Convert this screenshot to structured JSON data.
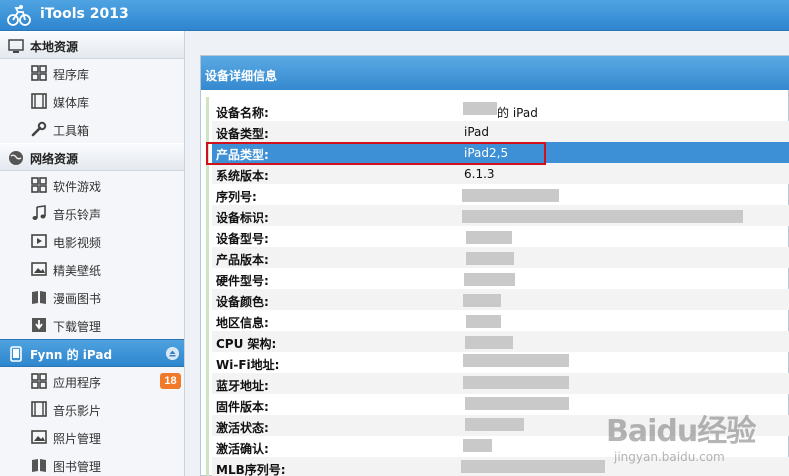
{
  "app": {
    "title": "iTools 2013"
  },
  "sidebar": {
    "sections": [
      {
        "label": "本地资源",
        "icon": "monitor-icon",
        "items": [
          {
            "label": "程序库",
            "icon": "grid-icon"
          },
          {
            "label": "媒体库",
            "icon": "film-icon"
          },
          {
            "label": "工具箱",
            "icon": "wrench-icon"
          }
        ]
      },
      {
        "label": "网络资源",
        "icon": "globe-icon",
        "items": [
          {
            "label": "软件游戏",
            "icon": "grid-icon"
          },
          {
            "label": "音乐铃声",
            "icon": "music-note-icon"
          },
          {
            "label": "电影视频",
            "icon": "video-icon"
          },
          {
            "label": "精美壁纸",
            "icon": "picture-icon"
          },
          {
            "label": "漫画图书",
            "icon": "book-icon"
          },
          {
            "label": "下载管理",
            "icon": "download-icon"
          }
        ]
      },
      {
        "label": "Fynn 的 iPad",
        "icon": "tablet-icon",
        "active": true,
        "items": [
          {
            "label": "应用程序",
            "icon": "grid-icon",
            "badge": "18"
          },
          {
            "label": "音乐影片",
            "icon": "film-icon"
          },
          {
            "label": "照片管理",
            "icon": "picture-icon"
          },
          {
            "label": "图书管理",
            "icon": "book-icon"
          }
        ]
      }
    ]
  },
  "panel": {
    "title": "设备详细信息",
    "rows": [
      {
        "key": "设备名称:",
        "value": "的 iPad"
      },
      {
        "key": "设备类型:",
        "value": "iPad"
      },
      {
        "key": "产品类型:",
        "value": "iPad2,5",
        "selected": true
      },
      {
        "key": "系统版本:",
        "value": "6.1.3"
      },
      {
        "key": "序列号:",
        "value": ""
      },
      {
        "key": "设备标识:",
        "value": ""
      },
      {
        "key": "设备型号:",
        "value": ""
      },
      {
        "key": "产品版本:",
        "value": ""
      },
      {
        "key": "硬件型号:",
        "value": ""
      },
      {
        "key": "设备颜色:",
        "value": ""
      },
      {
        "key": "地区信息:",
        "value": ""
      },
      {
        "key": "CPU 架构:",
        "value": ""
      },
      {
        "key": "Wi-Fi地址:",
        "value": ""
      },
      {
        "key": "蓝牙地址:",
        "value": ""
      },
      {
        "key": "固件版本:",
        "value": ""
      },
      {
        "key": "激活状态:",
        "value": ""
      },
      {
        "key": "激活确认:",
        "value": ""
      },
      {
        "key": "MLB序列号:",
        "value": ""
      }
    ]
  },
  "watermark": {
    "brand": "Baidu经验",
    "url": "jingyan.baidu.com"
  }
}
